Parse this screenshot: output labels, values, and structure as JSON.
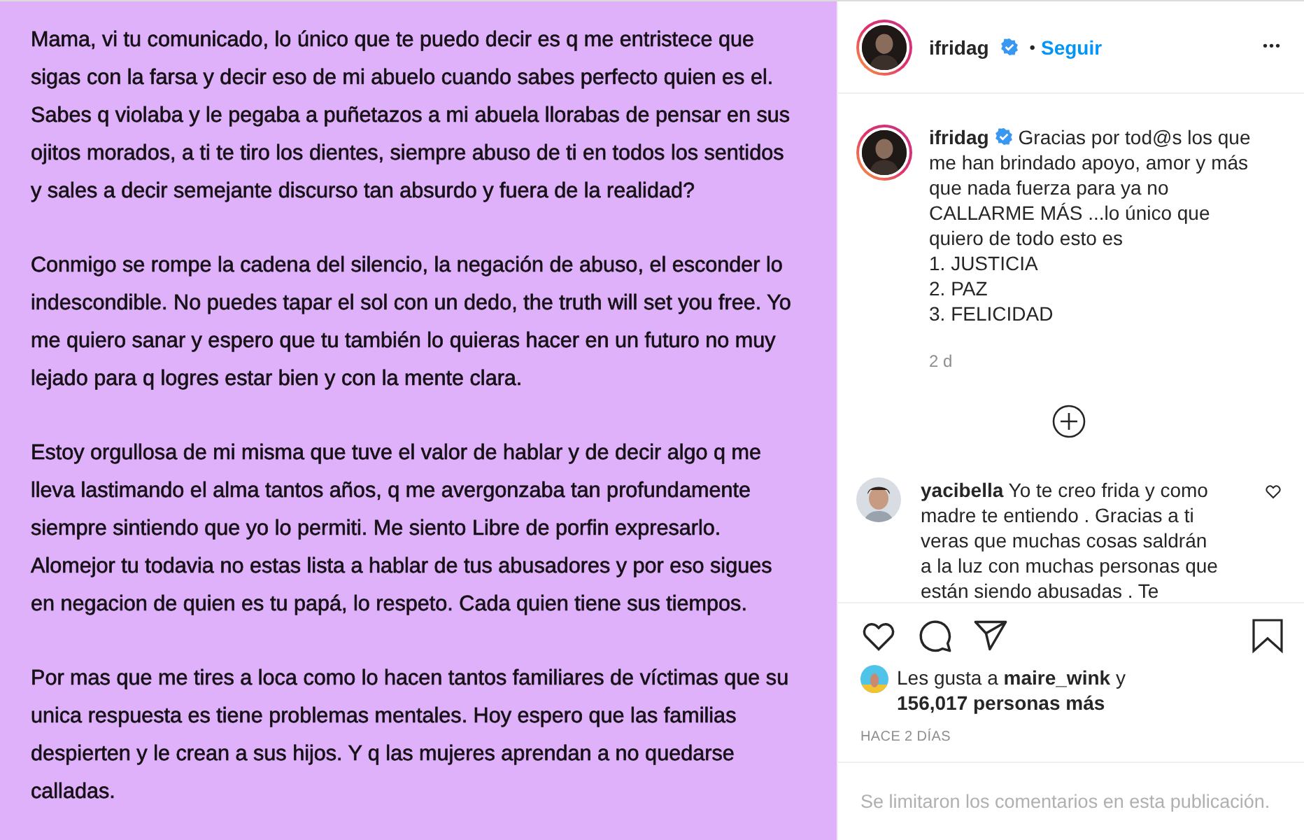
{
  "post_image": {
    "kind": "text-card",
    "paragraphs": [
      "Mama, vi tu comunicado, lo único que te puedo decir es q me entristece que sigas con la farsa y decir eso de mi abuelo cuando sabes perfecto quien es el. Sabes q violaba y le pegaba a puñetazos a mi abuela llorabas de pensar en sus ojitos morados, a ti te tiro los dientes, siempre abuso de ti en todos los sentidos y sales a decir semejante discurso tan absurdo y fuera de la realidad?",
      "Conmigo se rompe la cadena del silencio, la negación de abuso, el esconder lo indescondible. No puedes tapar el sol con un dedo, the truth will set you free. Yo me quiero sanar y espero que tu también lo quieras hacer en un futuro no muy lejado para q logres estar bien y con la mente clara.",
      "Estoy orgullosa de mi misma que tuve el valor de hablar y de decir algo q me lleva lastimando el alma tantos años, q me avergonzaba tan profundamente siempre sintiendo que yo lo permiti. Me siento Libre de porfin expresarlo. Alomejor tu todavia no estas lista a hablar de tus abusadores y por eso sigues en negacion de quien es tu papá, lo respeto. Cada quien tiene sus tiempos.",
      "Por mas que me tires a loca como lo hacen tantos familiares de víctimas que su unica respuesta es tiene problemas mentales. Hoy espero que las familias despierten y le crean a sus hijos. Y q las mujeres aprendan a no quedarse calladas."
    ]
  },
  "header": {
    "username": "ifridag",
    "verified": true,
    "separator": "•",
    "follow": "Seguir",
    "more": "•••"
  },
  "caption": {
    "username": "ifridag",
    "verified": true,
    "lines": [
      "Gracias por tod@s los que me han brindado apoyo, amor y más que nada fuerza para ya no CALLARME MÁS ...lo único que quiero de todo esto es",
      "1. JUSTICIA",
      "2. PAZ",
      "3. FELICIDAD"
    ],
    "time": "2 d"
  },
  "comments": [
    {
      "username": "yacibella",
      "text": "Yo te creo frida y como madre te entiendo . Gracias a ti veras que muchas cosas saldrán a la luz con muchas personas que están siendo abusadas . Te",
      "liked": false
    }
  ],
  "likes": {
    "prefix": "Les gusta a",
    "user": "maire_wink",
    "middle": "y",
    "count": "156,017 personas más"
  },
  "timestamp": "HACE 2 DÍAS",
  "comments_notice": "Se limitaron los comentarios en esta publicación."
}
